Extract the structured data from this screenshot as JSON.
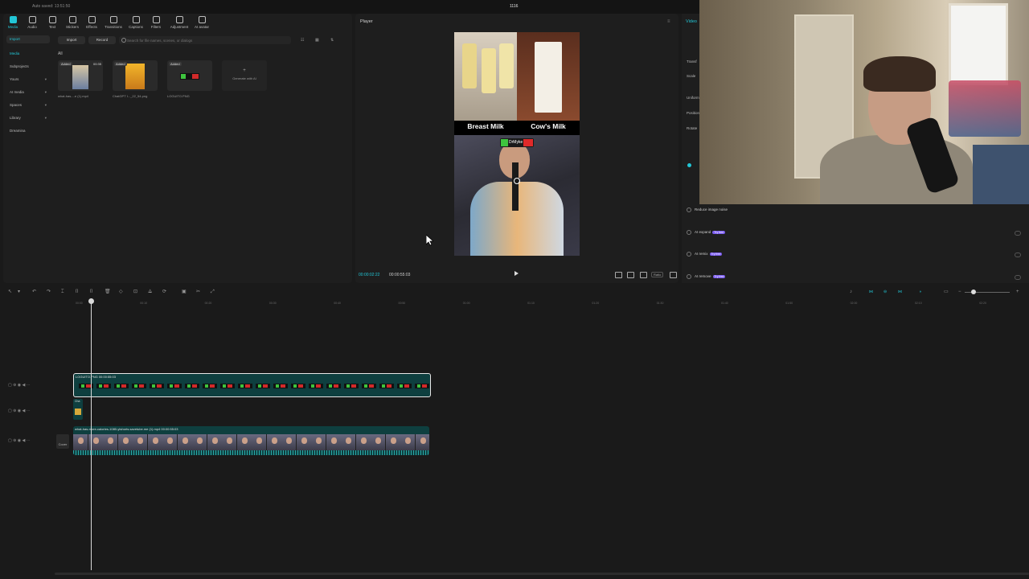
{
  "titlebar": {
    "autosave": "Auto saved: 13:51:50",
    "project": "1116"
  },
  "toolbar": [
    {
      "label": "Media",
      "active": true,
      "icon": "media-icon"
    },
    {
      "label": "Audio",
      "icon": "audio-icon"
    },
    {
      "label": "Text",
      "icon": "text-icon"
    },
    {
      "label": "Stickers",
      "icon": "stickers-icon"
    },
    {
      "label": "Effects",
      "icon": "effects-icon"
    },
    {
      "label": "Transitions",
      "icon": "transitions-icon"
    },
    {
      "label": "Captions",
      "icon": "captions-icon"
    },
    {
      "label": "Filters",
      "icon": "filters-icon"
    },
    {
      "label": "Adjustment",
      "icon": "adjustment-icon"
    },
    {
      "label": "AI avatar",
      "icon": "ai-avatar-icon"
    }
  ],
  "sidebar": [
    {
      "label": "Import",
      "active": true,
      "selected": true
    },
    {
      "label": "Media",
      "active": true
    },
    {
      "label": "Subprojects"
    },
    {
      "label": "Yours",
      "chevron": true
    },
    {
      "label": "AI media",
      "chevron": true
    },
    {
      "label": "Spaces",
      "chevron": true
    },
    {
      "label": "Library",
      "chevron": true
    },
    {
      "label": "Dreamina"
    }
  ],
  "media": {
    "import_label": "Import",
    "record_label": "Record",
    "search_placeholder": "Search for file names, scenes, or dialogs",
    "all_label": "All",
    "items": [
      {
        "badge": "Added",
        "duration": "00:35",
        "caption": "what-has-...e (1).mp4"
      },
      {
        "badge": "Added",
        "duration": "",
        "caption": "ChatGPT I..._22_54.png"
      },
      {
        "badge": "Added",
        "duration": "",
        "caption": "LOGUITO.PNG"
      }
    ],
    "generate_label": "Generate with AI"
  },
  "player": {
    "label": "Player",
    "current_time": "00:00:02:22",
    "total_time": "00:00:55:03",
    "ratio_label": "Ratio",
    "labels": {
      "left": "Breast Milk",
      "right": "Cow's Milk"
    },
    "logo_text": "DrMyke"
  },
  "right_panel": {
    "tab": "Video",
    "labels": [
      "Transf",
      "Scale",
      "Uniform",
      "Position",
      "Rotate"
    ],
    "rows": [
      {
        "label": "Reduce image noise",
        "badge": ""
      },
      {
        "label": "AI expand",
        "badge": "Try free"
      },
      {
        "label": "AI remix",
        "badge": "Try free"
      },
      {
        "label": "AI remove",
        "badge": "Try free"
      }
    ]
  },
  "timeline": {
    "ticks": [
      "00:00",
      "00:10",
      "00:20",
      "00:30",
      "00:40",
      "00:50",
      "01:00",
      "01:10",
      "01:20",
      "01:30",
      "01:40",
      "01:50",
      "02:00",
      "02:10",
      "02:20"
    ],
    "clip1_label": "LOGUITO.PNG  00:00:55:03",
    "clip2_label": "Cha",
    "clip3_label": "what-has-more-calories-1080-ytshorts.savetube.me (1).mp4  00:00:55:03",
    "cover_label": "Cover"
  },
  "colors": {
    "accent": "#22c6d6",
    "clip": "#0e3f3f",
    "try_badge": "#7b5cf0"
  }
}
